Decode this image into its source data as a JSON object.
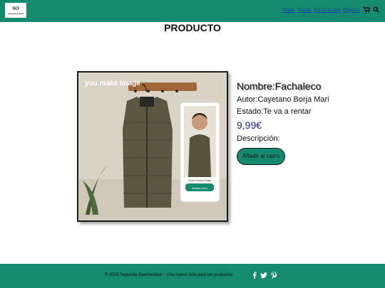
{
  "header": {
    "logo_text": "SO",
    "nav": [
      "Home",
      "Tienda",
      "Inicio Sesión",
      "Registro"
    ],
    "icons": [
      "cart-icon",
      "search-icon"
    ],
    "background": "#148a6e"
  },
  "page_title": "PRODUCTO",
  "product": {
    "image_watermark": "you make image",
    "image_card_caption": "Online Product Sales",
    "image_card_button": "Details Here",
    "name": "Nombre:Fachaleco",
    "author": "Autor:Cayetano Borja Mari",
    "state": "Estado:Te va a rentar",
    "price": "9,99€",
    "description": "Descripción:",
    "cart_button": "Añadir al carro"
  },
  "footer": {
    "text": "© 2025 Segunda Oportunidad – Una nueva vida para tus productos",
    "social": [
      "facebook-icon",
      "twitter-icon",
      "pinterest-icon"
    ]
  },
  "colors": {
    "accent": "#148a6e",
    "price": "#1a1aa6"
  }
}
